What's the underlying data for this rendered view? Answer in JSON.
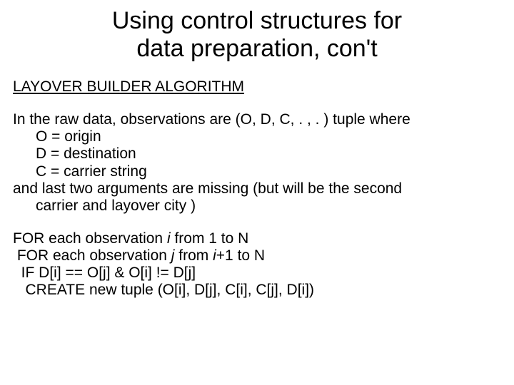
{
  "title_line1": "Using control structures for",
  "title_line2": "data preparation, con't",
  "subheading": "LAYOVER BUILDER ALGORITHM",
  "intro_line": "In the raw data, observations are (O, D, C, . , . ) tuple where",
  "def_O": "O = origin",
  "def_D": "D = destination",
  "def_C": "C = carrier string",
  "tail_line1": "and last two arguments are missing (but will be the second",
  "tail_line2": "carrier and layover city )",
  "algo": {
    "for_each": "FOR each observation ",
    "from_1_to_N": " from 1 to N",
    "from": " from ",
    "plus1_to_N": "+1 to N",
    "if_line": "  IF D[i] == O[j] & O[i] != D[j]",
    "create_line": "   CREATE new tuple (O[i], D[j], C[i], C[j], D[i])",
    "i": "i",
    "j": "j"
  }
}
